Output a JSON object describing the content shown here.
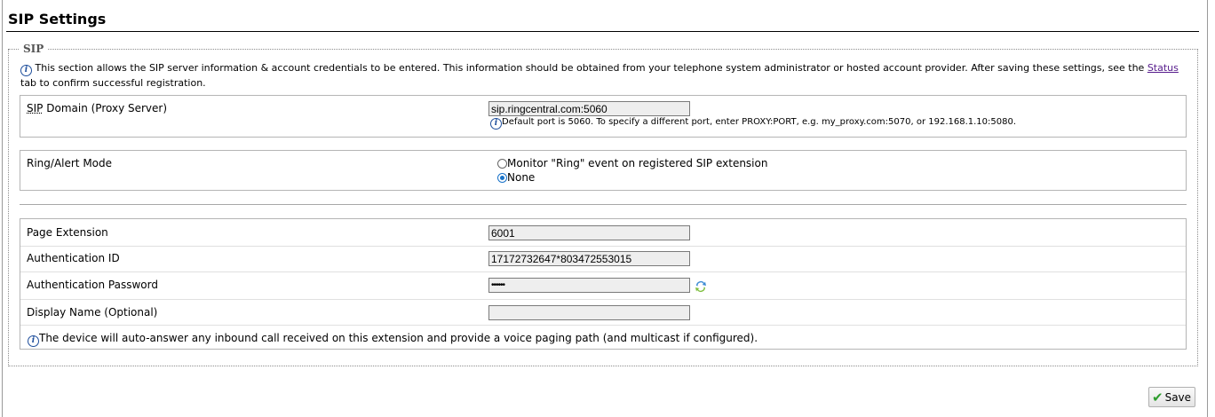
{
  "page": {
    "title": "SIP Settings"
  },
  "section": {
    "legend": "SIP",
    "intro_before_link": "This section allows the SIP server information & account credentials to be entered. This information should be obtained from your telephone system administrator or hosted account provider. After saving these settings, see the",
    "intro_link": "Status",
    "intro_after_link": "tab to confirm successful registration."
  },
  "domain": {
    "label_abbr": "SIP",
    "label_rest": "Domain (Proxy Server)",
    "value": "sip.ringcentral.com:5060",
    "hint": "Default port is 5060. To specify a different port, enter PROXY:PORT, e.g. my_proxy.com:5070, or 192.168.1.10:5080."
  },
  "ring_mode": {
    "label": "Ring/Alert Mode",
    "option_monitor": "Monitor \"Ring\" event on registered SIP extension",
    "option_none": "None",
    "selected": "None"
  },
  "account": {
    "page_extension_label": "Page Extension",
    "page_extension_value": "6001",
    "auth_id_label": "Authentication ID",
    "auth_id_value": "17172732647*803472553015",
    "auth_password_label": "Authentication Password",
    "auth_password_value": "••••••",
    "display_name_label": "Display Name (Optional)",
    "display_name_value": "",
    "note": "The device will auto-answer any inbound call received on this extension and provide a voice paging path (and multicast if configured)."
  },
  "buttons": {
    "save_label": "Save"
  },
  "icons": {
    "info": "info-icon",
    "refresh": "refresh-icon",
    "save": "checkmark-icon"
  },
  "colors": {
    "link": "#551a8b",
    "info": "#1f4f9c",
    "radio_selected": "#1a73c9",
    "save_check": "#2e9e2e"
  }
}
